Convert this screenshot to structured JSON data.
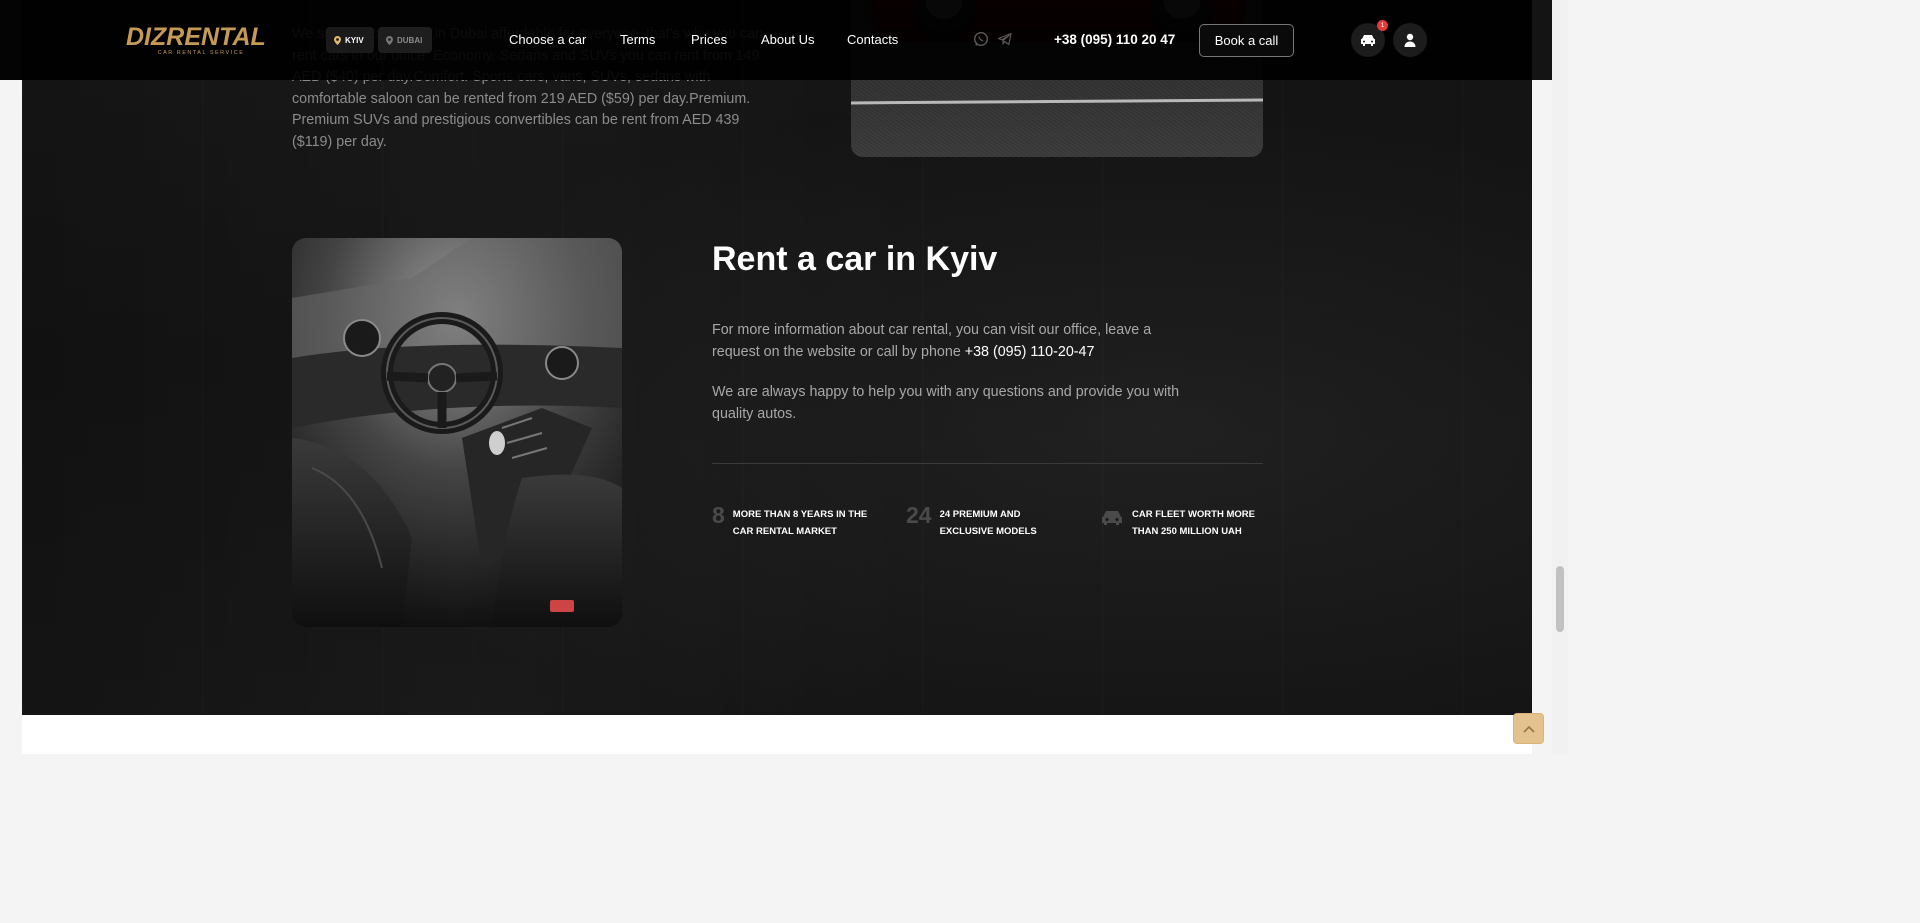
{
  "header": {
    "logo_text": "DIZRENTAL",
    "logo_subtitle": "CAR RENTAL SERVICE",
    "cities": [
      {
        "label": "KYIV",
        "active": true
      },
      {
        "label": "DUBAI",
        "active": false
      }
    ],
    "nav": [
      {
        "label": "Choose a car"
      },
      {
        "label": "Terms"
      },
      {
        "label": "Prices"
      },
      {
        "label": "About Us"
      },
      {
        "label": "Contacts"
      }
    ],
    "social_icons": [
      "whatsapp-icon",
      "telegram-icon"
    ],
    "phone": "+38 (095) 110 20 47",
    "book_button": "Book a call",
    "cart_count": "1",
    "cart_icon": "car-icon",
    "user_icon": "user-icon"
  },
  "top_section": {
    "paragraph": "We suggest car rental in Dubai affordable for everyone, that's why you can rent cars in our office: Economy. Sedans and SUVs you can rent from 149 AED ($40) per day.Comfort. Sports cars, vans, SUVs, sedans with comfortable saloon can be rented from 219 AED ($59) per day.Premium. Premium SUVs and prestigious convertibles can be rent from AED 439 ($119) per day."
  },
  "kyiv_section": {
    "title": "Rent a car in Kyiv",
    "para1_text": "For more information about car rental, you can visit our office, leave a request on the website or call by phone",
    "para1_phone": "+38 (095) 110-20-47",
    "para2": "We are always happy to help you with any questions and provide you with quality autos.",
    "stats": [
      {
        "number": "8",
        "label_line1": "MORE THAN 8 YEARS IN THE",
        "label_line2": "CAR RENTAL MARKET"
      },
      {
        "number": "24",
        "label_line1": "24 PREMIUM AND",
        "label_line2": "EXCLUSIVE MODELS"
      },
      {
        "icon": "car-icon",
        "label_line1": "CAR FLEET WORTH MORE",
        "label_line2": "THAN 250 MILLION UAH"
      }
    ]
  },
  "colors": {
    "brand_gold": "#c49a55",
    "background_dark": "#121212",
    "badge_red": "#e23b3b",
    "scroll_top_button": "#e4c28e"
  },
  "scroll_to_top_icon": "chevron-up-icon"
}
